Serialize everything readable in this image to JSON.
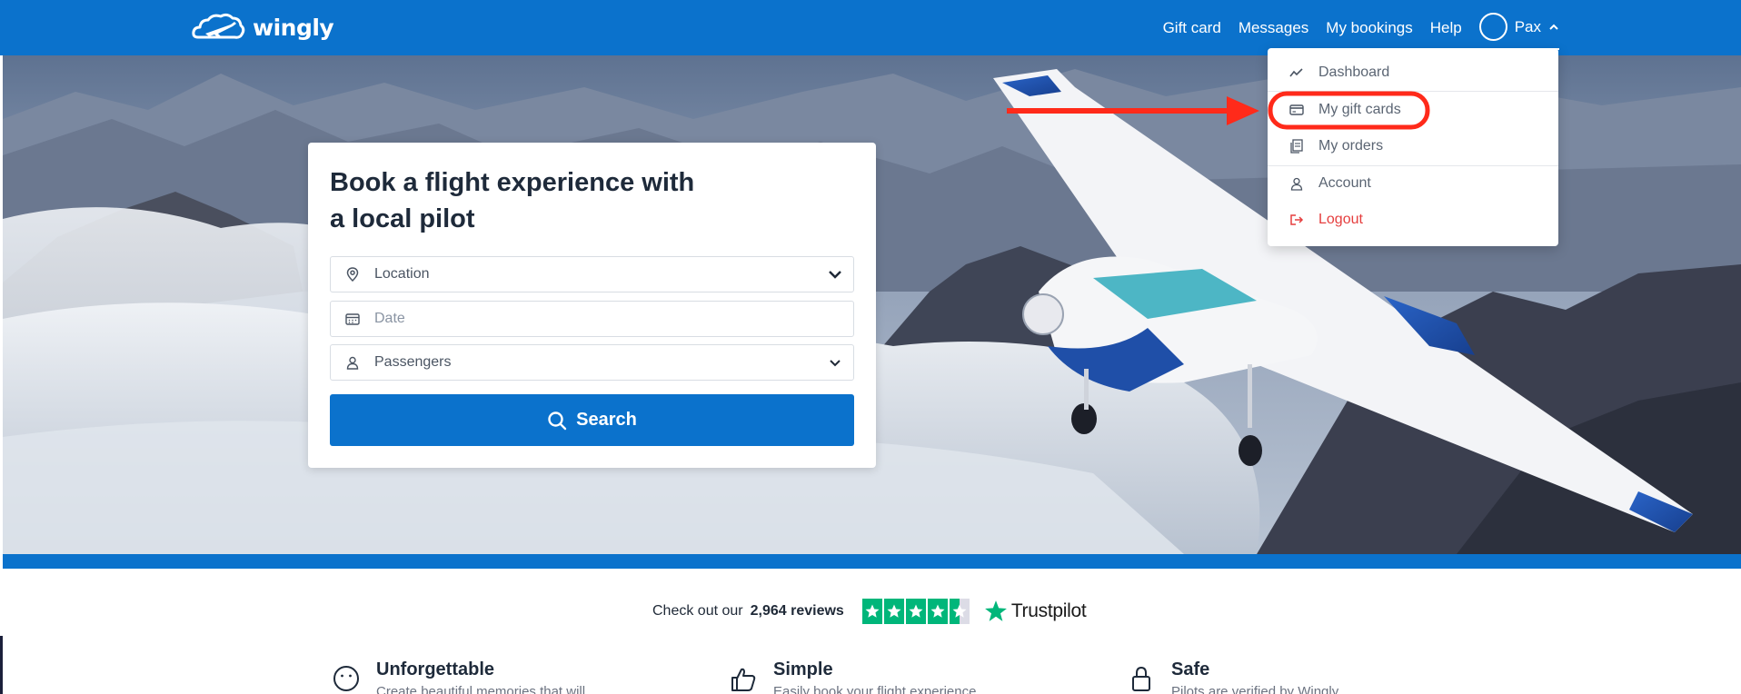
{
  "header": {
    "brand": "wingly",
    "nav": {
      "gift_card": "Gift card",
      "messages": "Messages",
      "my_bookings": "My bookings",
      "help": "Help",
      "user_name": "Pax"
    }
  },
  "search_card": {
    "title": "Book a flight experience with a local pilot",
    "location_placeholder": "Location",
    "date_placeholder": "Date",
    "passengers_placeholder": "Passengers",
    "search_label": "Search"
  },
  "user_menu": {
    "items": [
      {
        "label": "Dashboard",
        "icon": "chart-line-icon"
      },
      {
        "label": "My gift cards",
        "icon": "credit-card-icon"
      },
      {
        "label": "My orders",
        "icon": "receipt-icon"
      },
      {
        "label": "Account",
        "icon": "user-icon"
      },
      {
        "label": "Logout",
        "icon": "logout-icon"
      }
    ]
  },
  "reviews": {
    "prefix": "Check out our",
    "count": "2,964 reviews",
    "rating_stars": 4.5,
    "brand": "Trustpilot"
  },
  "features": [
    {
      "title": "Unforgettable",
      "description": "Create beautiful memories that will",
      "icon": "smile-icon"
    },
    {
      "title": "Simple",
      "description": "Easily book your flight experience",
      "icon": "thumbs-up-icon"
    },
    {
      "title": "Safe",
      "description": "Pilots are verified by Wingly",
      "icon": "lock-icon"
    }
  ],
  "colors": {
    "brand_blue": "#0b72cc",
    "trustpilot_green": "#00b67a",
    "logout_red": "#e53e3e",
    "annotation_red": "#ff2a1a"
  }
}
